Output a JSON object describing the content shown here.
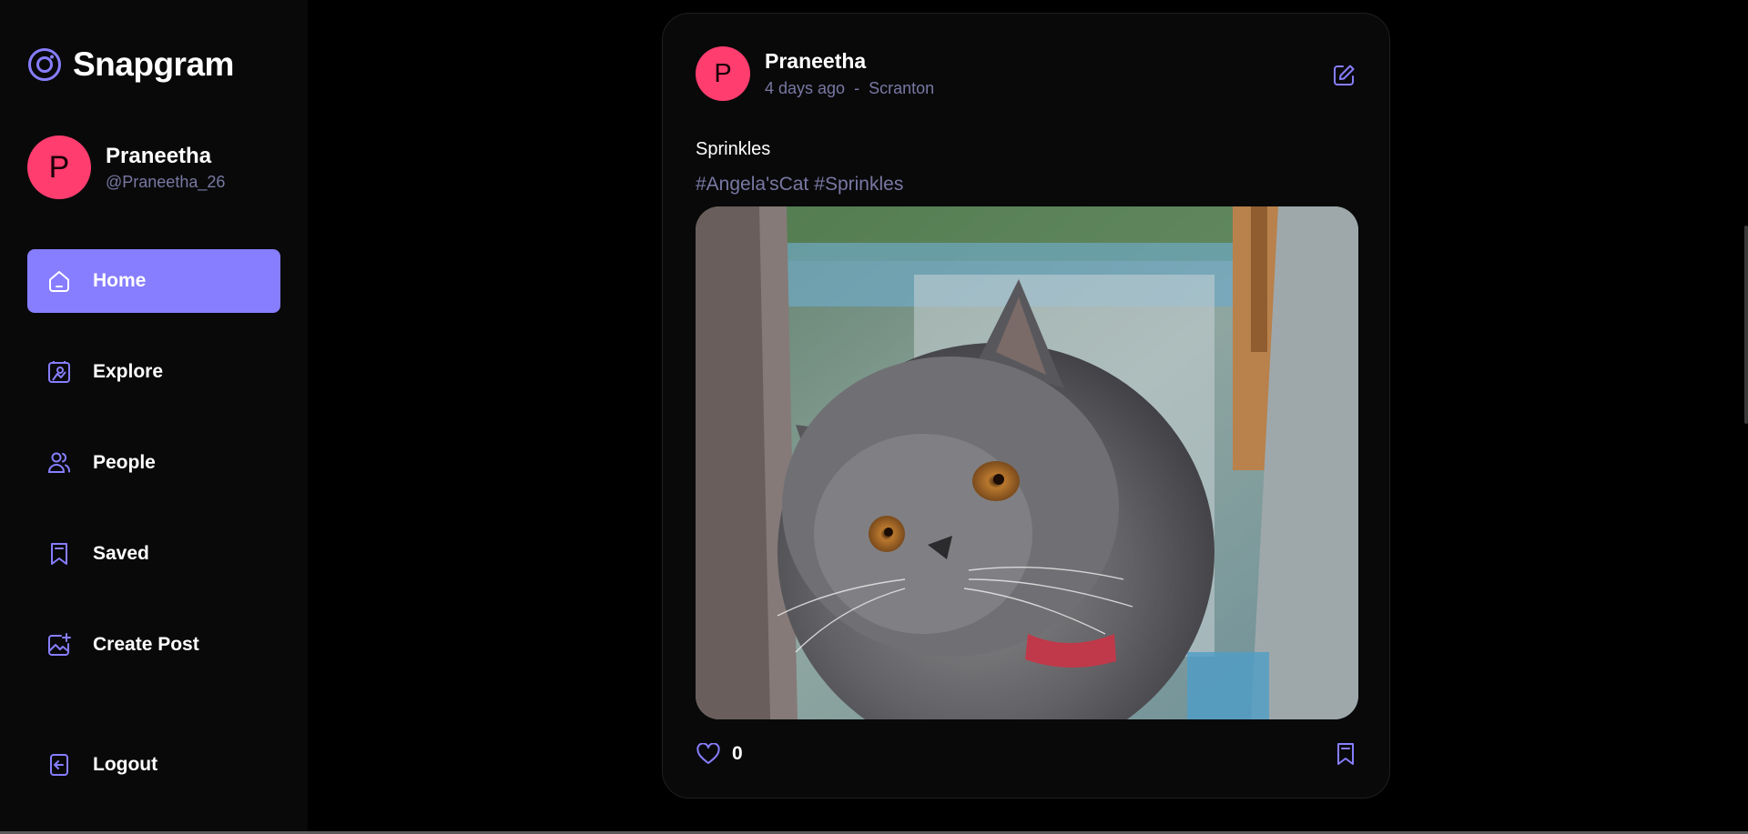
{
  "brand": {
    "name": "Snapgram",
    "accent": "#877eff"
  },
  "user": {
    "initial": "P",
    "name": "Praneetha",
    "handle": "@Praneetha_26"
  },
  "nav": {
    "items": [
      {
        "label": "Home",
        "icon": "home-icon",
        "active": true
      },
      {
        "label": "Explore",
        "icon": "explore-icon"
      },
      {
        "label": "People",
        "icon": "people-icon"
      },
      {
        "label": "Saved",
        "icon": "bookmark-icon"
      },
      {
        "label": "Create Post",
        "icon": "create-post-icon"
      }
    ],
    "logout_label": "Logout"
  },
  "post": {
    "author_initial": "P",
    "author": "Praneetha",
    "time_ago": "4 days ago",
    "separator": "-",
    "location": "Scranton",
    "caption": "Sprinkles",
    "tags": [
      "#Angela'sCat",
      "#Sprinkles"
    ],
    "image_alt": "grey kitten",
    "likes": "0"
  }
}
